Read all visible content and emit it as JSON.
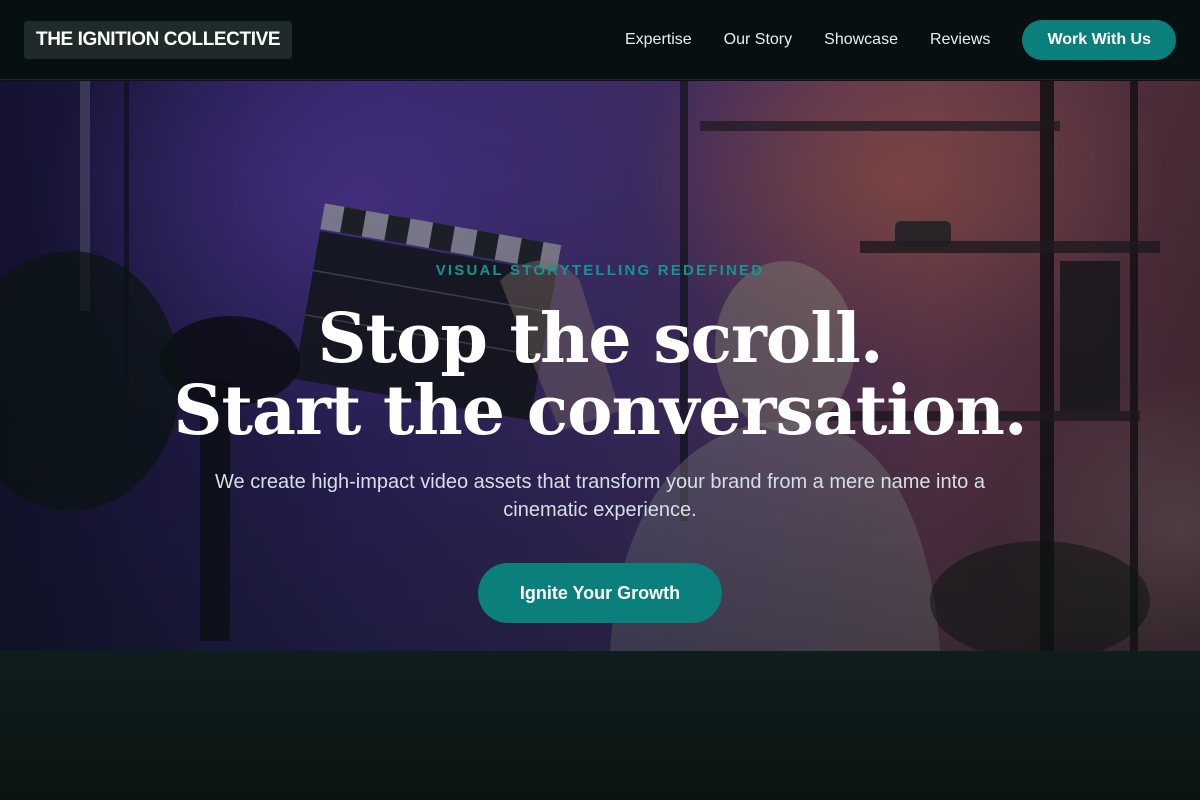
{
  "header": {
    "logo": "THE IGNITION COLLECTIVE",
    "nav": [
      {
        "label": "Expertise"
      },
      {
        "label": "Our Story"
      },
      {
        "label": "Showcase"
      },
      {
        "label": "Reviews"
      }
    ],
    "cta_label": "Work With Us"
  },
  "hero": {
    "eyebrow": "VISUAL STORYTELLING REDEFINED",
    "headline_line1": "Stop the scroll.",
    "headline_line2": "Start the conversation.",
    "subtext": "We create high-impact video assets that transform your brand from a mere name into a cinematic experience.",
    "cta_label": "Ignite Your Growth",
    "background_image": "studio-scene-woman-clapperboard"
  },
  "colors": {
    "accent": "#0a7f7c",
    "eyebrow": "#159590",
    "header_bg": "#071010",
    "page_bg": "#0a1414"
  }
}
